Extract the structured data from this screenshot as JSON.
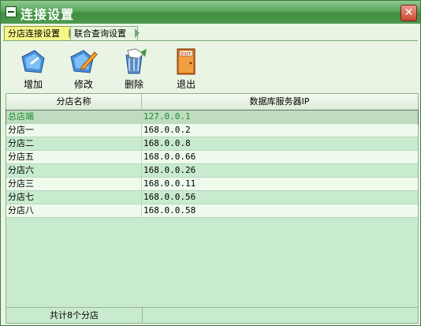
{
  "window": {
    "title": "连接设置",
    "close_symbol": "✕"
  },
  "tabs": [
    {
      "label": "分店连接设置",
      "active": true
    },
    {
      "label": "联合查询设置",
      "active": false
    }
  ],
  "toolbar": {
    "add_label": "增加",
    "edit_label": "修改",
    "delete_label": "删除",
    "exit_label": "退出",
    "exit_sign": "EXIT"
  },
  "table": {
    "columns": [
      "分店名称",
      "数据库服务器IP"
    ],
    "rows": [
      {
        "name": "总店端",
        "ip": "127.0.0.1"
      },
      {
        "name": "分店一",
        "ip": "168.0.0.2"
      },
      {
        "name": "分店二",
        "ip": "168.0.0.8"
      },
      {
        "name": "分店五",
        "ip": "168.0.0.66"
      },
      {
        "name": "分店六",
        "ip": "168.0.0.26"
      },
      {
        "name": "分店三",
        "ip": "168.0.0.11"
      },
      {
        "name": "分店七",
        "ip": "168.0.0.56"
      },
      {
        "name": "分店八",
        "ip": "168.0.0.58"
      }
    ],
    "footer": "共计8个分店"
  },
  "colors": {
    "accent": "#4f9a4f",
    "selected_text": "#1b8d2b",
    "row_light": "#eefbec",
    "row_green": "#c8ebcf"
  }
}
